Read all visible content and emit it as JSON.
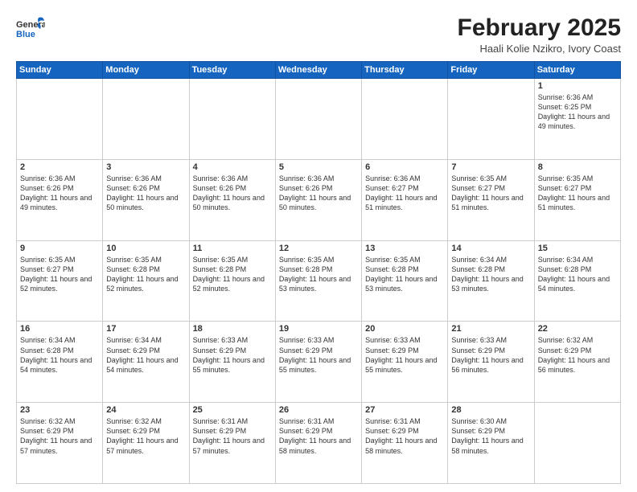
{
  "header": {
    "logo_general": "General",
    "logo_blue": "Blue",
    "month_title": "February 2025",
    "location": "Haali Kolie Nzikro, Ivory Coast"
  },
  "days_of_week": [
    "Sunday",
    "Monday",
    "Tuesday",
    "Wednesday",
    "Thursday",
    "Friday",
    "Saturday"
  ],
  "weeks": [
    [
      {
        "day": "",
        "info": ""
      },
      {
        "day": "",
        "info": ""
      },
      {
        "day": "",
        "info": ""
      },
      {
        "day": "",
        "info": ""
      },
      {
        "day": "",
        "info": ""
      },
      {
        "day": "",
        "info": ""
      },
      {
        "day": "1",
        "info": "Sunrise: 6:36 AM\nSunset: 6:25 PM\nDaylight: 11 hours and 49 minutes."
      }
    ],
    [
      {
        "day": "2",
        "info": "Sunrise: 6:36 AM\nSunset: 6:26 PM\nDaylight: 11 hours and 49 minutes."
      },
      {
        "day": "3",
        "info": "Sunrise: 6:36 AM\nSunset: 6:26 PM\nDaylight: 11 hours and 50 minutes."
      },
      {
        "day": "4",
        "info": "Sunrise: 6:36 AM\nSunset: 6:26 PM\nDaylight: 11 hours and 50 minutes."
      },
      {
        "day": "5",
        "info": "Sunrise: 6:36 AM\nSunset: 6:26 PM\nDaylight: 11 hours and 50 minutes."
      },
      {
        "day": "6",
        "info": "Sunrise: 6:36 AM\nSunset: 6:27 PM\nDaylight: 11 hours and 51 minutes."
      },
      {
        "day": "7",
        "info": "Sunrise: 6:35 AM\nSunset: 6:27 PM\nDaylight: 11 hours and 51 minutes."
      },
      {
        "day": "8",
        "info": "Sunrise: 6:35 AM\nSunset: 6:27 PM\nDaylight: 11 hours and 51 minutes."
      }
    ],
    [
      {
        "day": "9",
        "info": "Sunrise: 6:35 AM\nSunset: 6:27 PM\nDaylight: 11 hours and 52 minutes."
      },
      {
        "day": "10",
        "info": "Sunrise: 6:35 AM\nSunset: 6:28 PM\nDaylight: 11 hours and 52 minutes."
      },
      {
        "day": "11",
        "info": "Sunrise: 6:35 AM\nSunset: 6:28 PM\nDaylight: 11 hours and 52 minutes."
      },
      {
        "day": "12",
        "info": "Sunrise: 6:35 AM\nSunset: 6:28 PM\nDaylight: 11 hours and 53 minutes."
      },
      {
        "day": "13",
        "info": "Sunrise: 6:35 AM\nSunset: 6:28 PM\nDaylight: 11 hours and 53 minutes."
      },
      {
        "day": "14",
        "info": "Sunrise: 6:34 AM\nSunset: 6:28 PM\nDaylight: 11 hours and 53 minutes."
      },
      {
        "day": "15",
        "info": "Sunrise: 6:34 AM\nSunset: 6:28 PM\nDaylight: 11 hours and 54 minutes."
      }
    ],
    [
      {
        "day": "16",
        "info": "Sunrise: 6:34 AM\nSunset: 6:28 PM\nDaylight: 11 hours and 54 minutes."
      },
      {
        "day": "17",
        "info": "Sunrise: 6:34 AM\nSunset: 6:29 PM\nDaylight: 11 hours and 54 minutes."
      },
      {
        "day": "18",
        "info": "Sunrise: 6:33 AM\nSunset: 6:29 PM\nDaylight: 11 hours and 55 minutes."
      },
      {
        "day": "19",
        "info": "Sunrise: 6:33 AM\nSunset: 6:29 PM\nDaylight: 11 hours and 55 minutes."
      },
      {
        "day": "20",
        "info": "Sunrise: 6:33 AM\nSunset: 6:29 PM\nDaylight: 11 hours and 55 minutes."
      },
      {
        "day": "21",
        "info": "Sunrise: 6:33 AM\nSunset: 6:29 PM\nDaylight: 11 hours and 56 minutes."
      },
      {
        "day": "22",
        "info": "Sunrise: 6:32 AM\nSunset: 6:29 PM\nDaylight: 11 hours and 56 minutes."
      }
    ],
    [
      {
        "day": "23",
        "info": "Sunrise: 6:32 AM\nSunset: 6:29 PM\nDaylight: 11 hours and 57 minutes."
      },
      {
        "day": "24",
        "info": "Sunrise: 6:32 AM\nSunset: 6:29 PM\nDaylight: 11 hours and 57 minutes."
      },
      {
        "day": "25",
        "info": "Sunrise: 6:31 AM\nSunset: 6:29 PM\nDaylight: 11 hours and 57 minutes."
      },
      {
        "day": "26",
        "info": "Sunrise: 6:31 AM\nSunset: 6:29 PM\nDaylight: 11 hours and 58 minutes."
      },
      {
        "day": "27",
        "info": "Sunrise: 6:31 AM\nSunset: 6:29 PM\nDaylight: 11 hours and 58 minutes."
      },
      {
        "day": "28",
        "info": "Sunrise: 6:30 AM\nSunset: 6:29 PM\nDaylight: 11 hours and 58 minutes."
      },
      {
        "day": "",
        "info": ""
      }
    ]
  ]
}
